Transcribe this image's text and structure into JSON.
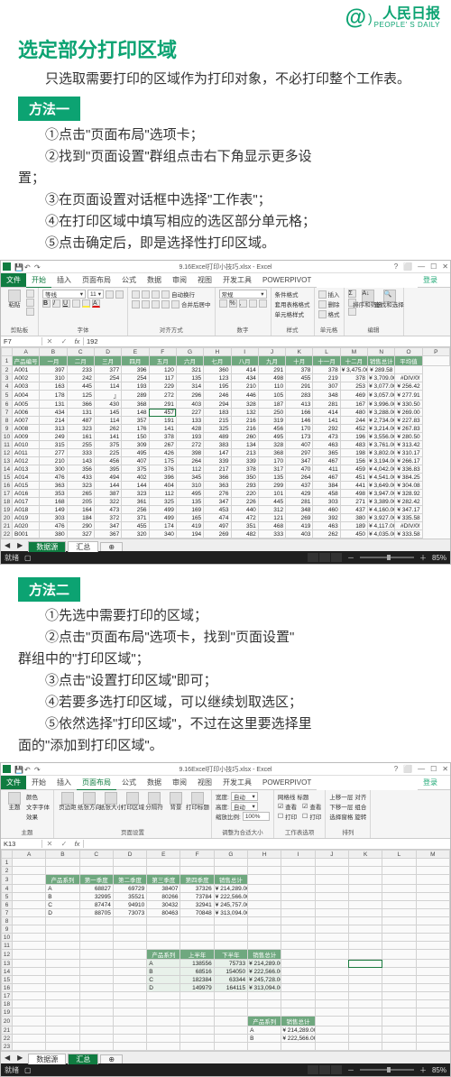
{
  "brand": {
    "at": "@",
    "cn": "人民日报",
    "en": "PEOPLE' S DAILY",
    "tm": "™"
  },
  "title": "选定部分打印区域",
  "intro": "只选取需要打印的区域作为打印对象，不必打印整个工作表。",
  "method1": {
    "label": "方法一",
    "steps": [
      "①点击\"页面布局\"选项卡；",
      "②找到\"页面设置\"群组点击右下角显示更多设置；",
      "③在页面设置对话框中选择\"工作表\"；",
      "④在打印区域中填写相应的选区部分单元格；",
      "⑤点击确定后，即是选择性打印区域。"
    ]
  },
  "method2": {
    "label": "方法二",
    "steps": [
      "①先选中需要打印的区域；",
      "②点击\"页面布局\"选项卡，找到\"页面设置\"群组中的\"打印区域\"；",
      "③点击\"设置打印区域\"即可；",
      "④若要多选打印区域，可以继续划取选区；",
      "⑤依然选择\"打印区域\"，不过在这里要选择里面的\"添加到打印区域\"。"
    ]
  },
  "excel": {
    "title": "9.16Excel打印小技巧.xlsx - Excel",
    "tabs": {
      "file": "文件",
      "home": "开始",
      "insert": "插入",
      "pagelayout": "页面布局",
      "formulas": "公式",
      "data": "数据",
      "review": "审阅",
      "view": "视图",
      "devtools": "开发工具",
      "powerpivot": "POWERPIVOT",
      "login": "登录"
    },
    "ribbon_home": {
      "clipboard": {
        "label": "剪贴板",
        "paste": "粘贴"
      },
      "font": {
        "label": "字体",
        "face": "等线",
        "size": "11"
      },
      "align": {
        "label": "对齐方式",
        "wrap": "自动换行",
        "merge": "合并后居中"
      },
      "number": {
        "label": "数字",
        "format": "常规"
      },
      "styles": {
        "label": "样式",
        "cond": "条件格式",
        "tbl": "套用表格格式",
        "cell": "单元格样式"
      },
      "cells": {
        "label": "单元格"
      },
      "editing": {
        "label": "编辑",
        "sort": "排序和筛选",
        "find": "查找和选择"
      }
    },
    "ribbon_page": {
      "themes": {
        "label": "主题",
        "theme": "主题",
        "color": "颜色",
        "font": "文字字体",
        "fx": "效果"
      },
      "setup": {
        "label": "页面设置",
        "margin": "页边距",
        "orient": "纸张方向",
        "size": "纸张大小",
        "area": "打印区域",
        "break": "分隔符",
        "bg": "背景",
        "titles": "打印标题"
      },
      "scale": {
        "label": "调整为合适大小",
        "w": "宽度:",
        "h": "高度:",
        "s": "缩放比例:",
        "auto": "自动",
        "pct": "100%"
      },
      "sheetopt": {
        "label": "工作表选项",
        "grid": "网格线",
        "head": "标题",
        "view": "查看",
        "print": "打印"
      },
      "arrange": {
        "label": "排列",
        "up": "上移一层",
        "down": "下移一层",
        "align": "对齐",
        "sel": "选择窗格",
        "rot": "旋转"
      }
    },
    "namebox1": "F7",
    "formula1": "192",
    "namebox2": "K13",
    "formula2": "",
    "cols": [
      "A",
      "B",
      "C",
      "D",
      "E",
      "F",
      "G",
      "H",
      "I",
      "J",
      "K",
      "L",
      "M",
      "N",
      "O",
      "P"
    ],
    "headers": [
      "产品编号",
      "一月",
      "二月",
      "三月",
      "四月",
      "五月",
      "六月",
      "七月",
      "八月",
      "九月",
      "十月",
      "十一月",
      "十二月",
      "销售总计",
      "平均值"
    ],
    "rows": [
      [
        "A001",
        "397",
        "233",
        "377",
        "396",
        "120",
        "321",
        "360",
        "414",
        "291",
        "378",
        "378",
        "¥ 3,475.00",
        "¥ 289.58"
      ],
      [
        "A002",
        "310",
        "242",
        "254",
        "254",
        "117",
        "135",
        "123",
        "434",
        "498",
        "455",
        "219",
        "378",
        "¥ 3,709.00",
        "#DIV/0!"
      ],
      [
        "A003",
        "163",
        "445",
        "114",
        "193",
        "229",
        "314",
        "195",
        "210",
        "110",
        "291",
        "307",
        "253",
        "¥ 3,077.00",
        "¥ 256.42"
      ],
      [
        "A004",
        "178",
        "125",
        "』",
        "289",
        "272",
        "296",
        "246",
        "446",
        "105",
        "283",
        "348",
        "469",
        "¥ 3,057.00",
        "¥ 277.91"
      ],
      [
        "A005",
        "131",
        "366",
        "430",
        "368",
        "291",
        "403",
        "294",
        "328",
        "187",
        "413",
        "281",
        "167",
        "¥ 3,996.00",
        "¥ 330.50"
      ],
      [
        "A006",
        "434",
        "131",
        "145",
        "148",
        "457",
        "227",
        "183",
        "132",
        "250",
        "166",
        "414",
        "480",
        "¥ 3,288.00",
        "¥ 269.00"
      ],
      [
        "A007",
        "214",
        "487",
        "114",
        "357",
        "191",
        "133",
        "215",
        "216",
        "319",
        "146",
        "141",
        "244",
        "¥ 2,734.00",
        "¥ 227.83"
      ],
      [
        "A008",
        "313",
        "323",
        "262",
        "176",
        "141",
        "428",
        "325",
        "216",
        "456",
        "170",
        "292",
        "452",
        "¥ 3,214.00",
        "¥ 267.83"
      ],
      [
        "A009",
        "249",
        "161",
        "141",
        "150",
        "378",
        "193",
        "489",
        "260",
        "495",
        "173",
        "473",
        "196",
        "¥ 3,556.00",
        "¥ 280.50"
      ],
      [
        "A010",
        "315",
        "255",
        "375",
        "309",
        "267",
        "272",
        "383",
        "134",
        "328",
        "407",
        "463",
        "483",
        "¥ 3,761.00",
        "¥ 313.42"
      ],
      [
        "A011",
        "277",
        "333",
        "225",
        "495",
        "426",
        "398",
        "147",
        "213",
        "368",
        "297",
        "365",
        "198",
        "¥ 3,802.00",
        "¥ 310.17"
      ],
      [
        "A012",
        "210",
        "143",
        "456",
        "407",
        "175",
        "264",
        "339",
        "339",
        "170",
        "347",
        "467",
        "156",
        "¥ 3,194.00",
        "¥ 266.17"
      ],
      [
        "A013",
        "300",
        "356",
        "395",
        "375",
        "376",
        "112",
        "217",
        "378",
        "317",
        "470",
        "411",
        "459",
        "¥ 4,042.00",
        "¥ 336.83"
      ],
      [
        "A014",
        "476",
        "433",
        "494",
        "402",
        "396",
        "345",
        "366",
        "350",
        "135",
        "264",
        "467",
        "451",
        "¥ 4,541.00",
        "¥ 384.25"
      ],
      [
        "A015",
        "363",
        "323",
        "144",
        "144",
        "404",
        "310",
        "363",
        "293",
        "299",
        "437",
        "384",
        "441",
        "¥ 3,649.00",
        "¥ 304.08"
      ],
      [
        "A016",
        "353",
        "265",
        "387",
        "323",
        "112",
        "495",
        "276",
        "220",
        "101",
        "429",
        "458",
        "498",
        "¥ 3,947.00",
        "¥ 328.92"
      ],
      [
        "A017",
        "168",
        "205",
        "322",
        "361",
        "325",
        "135",
        "347",
        "226",
        "445",
        "281",
        "303",
        "271",
        "¥ 3,389.00",
        "¥ 282.42"
      ],
      [
        "A018",
        "149",
        "164",
        "473",
        "256",
        "499",
        "169",
        "453",
        "440",
        "312",
        "348",
        "460",
        "437",
        "¥ 4,160.00",
        "¥ 347.17"
      ],
      [
        "A019",
        "303",
        "184",
        "372",
        "371",
        "499",
        "165",
        "474",
        "472",
        "121",
        "269",
        "392",
        "380",
        "¥ 3,927.00",
        "¥ 335.58"
      ],
      [
        "A020",
        "476",
        "290",
        "347",
        "455",
        "174",
        "419",
        "497",
        "351",
        "468",
        "419",
        "463",
        "189",
        "¥ 4,117.00",
        "#DIV/0!"
      ],
      [
        "B001",
        "380",
        "327",
        "367",
        "320",
        "340",
        "194",
        "269",
        "482",
        "333",
        "403",
        "262",
        "450",
        "¥ 4,035.00",
        "¥ 333.58"
      ]
    ],
    "sheet_src": "数据源",
    "sheet_sum": "汇总",
    "sheet_plus": "⊕",
    "status_ready": "就绪",
    "zoom_pct": "85%",
    "table2_head": [
      "产品系列",
      "第一季度",
      "第二季度",
      "第三季度",
      "第四季度",
      "销售总计"
    ],
    "table2_rows": [
      [
        "A",
        "68827",
        "69729",
        "38407",
        "37326",
        "¥ 214,289.00"
      ],
      [
        "B",
        "32995",
        "35521",
        "80266",
        "73784",
        "¥ 222,566.00"
      ],
      [
        "C",
        "87474",
        "94910",
        "30432",
        "32941",
        "¥ 245,757.00"
      ],
      [
        "D",
        "88705",
        "73073",
        "80463",
        "70848",
        "¥ 313,094.00"
      ]
    ],
    "table3_head": [
      "产品系列",
      "上半年",
      "下半年",
      "销售总计"
    ],
    "table3_rows": [
      [
        "A",
        "138556",
        "75733",
        "¥ 214,289.00"
      ],
      [
        "B",
        "68516",
        "154050",
        "¥ 222,566.00"
      ],
      [
        "C",
        "182384",
        "63344",
        "¥ 245,728.00"
      ],
      [
        "D",
        "149979",
        "164115",
        "¥ 313,094.00"
      ]
    ],
    "table4_head": [
      "产品系列",
      "销售总计"
    ],
    "table4_rows": [
      [
        "A",
        "¥ 214,289.00"
      ],
      [
        "B",
        "¥ 222,566.00"
      ]
    ]
  }
}
